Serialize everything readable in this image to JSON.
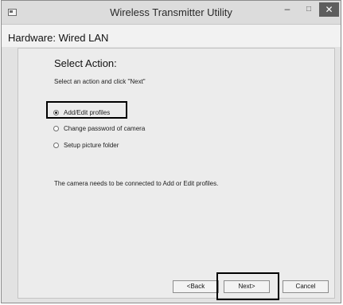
{
  "window": {
    "title": "Wireless Transmitter Utility",
    "minimize_glyph": "–",
    "maximize_glyph": "□",
    "close_glyph": "✕"
  },
  "header": {
    "hardware_label": "Hardware: Wired LAN"
  },
  "main": {
    "heading": "Select Action:",
    "instruction": "Select an action and click \"Next\"",
    "options": [
      {
        "label": "Add/Edit profiles",
        "selected": true
      },
      {
        "label": "Change password of camera",
        "selected": false
      },
      {
        "label": "Setup picture folder",
        "selected": false
      }
    ],
    "note": "The camera needs to be connected to Add or Edit profiles."
  },
  "footer": {
    "back_label": "<Back",
    "next_label": "Next>",
    "cancel_label": "Cancel"
  }
}
